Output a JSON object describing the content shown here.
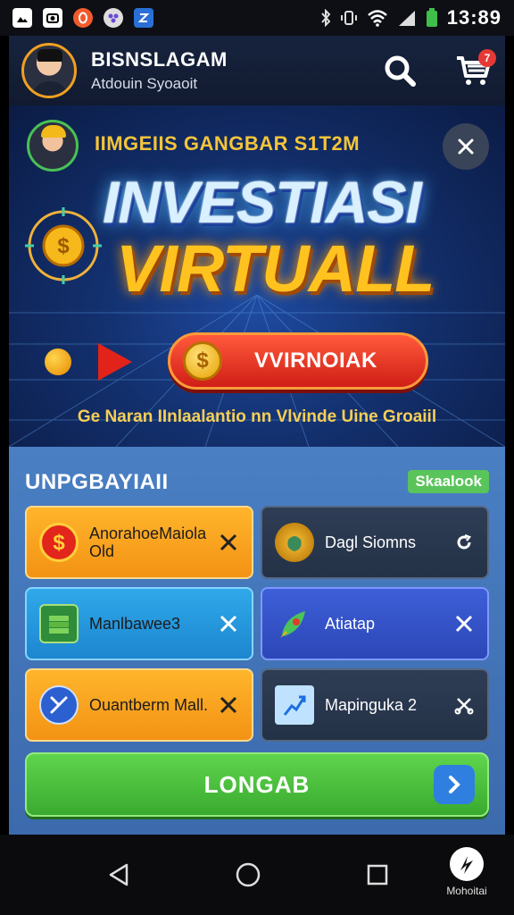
{
  "status_bar": {
    "time": "13:89",
    "left_icons": [
      "gallery-icon",
      "camera-icon",
      "opera-icon",
      "assistant-icon",
      "app-icon"
    ],
    "right_icons": [
      "bluetooth-icon",
      "vibrate-icon",
      "wifi-icon",
      "signal-icon",
      "battery-icon"
    ]
  },
  "header": {
    "app_name": "BISNSLAGAM",
    "subtitle": "Atdouin Syoaoit",
    "cart_badge": "7"
  },
  "banner": {
    "tagline": "IIMGEIIS GANGBAR S1T2M",
    "title_line1": "INVESTIASI",
    "title_line2": "VIRTUALL",
    "cta_label": "VVIRNOIAK",
    "cta_coin_symbol": "$",
    "caption": "Ge Naran IInlaalantio nn Vlvinde Uine Groaiil"
  },
  "categories": {
    "title": "UNPGBAYIAII",
    "view_all": "Skaalook",
    "tiles": [
      {
        "label": "AnorahoeMaiola Old",
        "icon": "dollar-coin-icon",
        "action": "close-icon",
        "style": "orange"
      },
      {
        "label": "Dagl Siomns",
        "icon": "gold-bag-icon",
        "action": "refresh-icon",
        "style": "dark"
      },
      {
        "label": "Manlbawee3",
        "icon": "cash-stack-icon",
        "action": "close-icon",
        "style": "cyan"
      },
      {
        "label": "Atiatap",
        "icon": "rocket-icon",
        "action": "close-icon",
        "style": "blue"
      },
      {
        "label": "Ouantberm Mall.",
        "icon": "tools-icon",
        "action": "close-icon",
        "style": "orange"
      },
      {
        "label": "Mapinguka 2",
        "icon": "chart-icon",
        "action": "scissors-icon",
        "style": "dark"
      }
    ],
    "load_button": "LONGAB"
  },
  "nav": {
    "brand_label": "Mohoitai"
  },
  "colors": {
    "banner_bg": "#13306e",
    "title_blue": "#d8f0ff",
    "title_gold": "#ffc21f",
    "cta_red": "#d01e16",
    "panel_blue": "#4a7fc3",
    "load_green": "#3aaa2f"
  }
}
